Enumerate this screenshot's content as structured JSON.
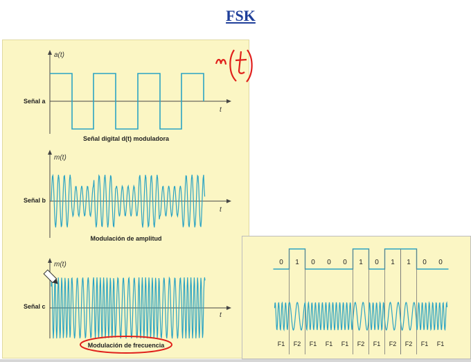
{
  "title": "FSK",
  "signal_a": {
    "row_label": "Señal a",
    "axis_y": "a(t)",
    "axis_x": "t",
    "caption": "Señal digital d(t) moduladora"
  },
  "signal_b": {
    "row_label": "Señal b",
    "axis_y": "m(t)",
    "axis_x": "t",
    "caption": "Modulación de amplitud"
  },
  "signal_c": {
    "row_label": "Señal c",
    "axis_y": "m(t)",
    "axis_x": "t",
    "caption": "Modulación de frecuencia"
  },
  "annotation": "m(t)",
  "fsk_example": {
    "bits": [
      "0",
      "1",
      "0",
      "0",
      "0",
      "1",
      "0",
      "1",
      "1",
      "0",
      "0"
    ],
    "freqs": [
      "F1",
      "F2",
      "F1",
      "F1",
      "F1",
      "F2",
      "F1",
      "F2",
      "F2",
      "F1",
      "F1"
    ]
  },
  "colors": {
    "signal": "#2aa3c3",
    "axis": "#444444",
    "panel_bg": "#fbf6c4",
    "title": "#1f3f9a",
    "annotation": "#e0201b"
  }
}
